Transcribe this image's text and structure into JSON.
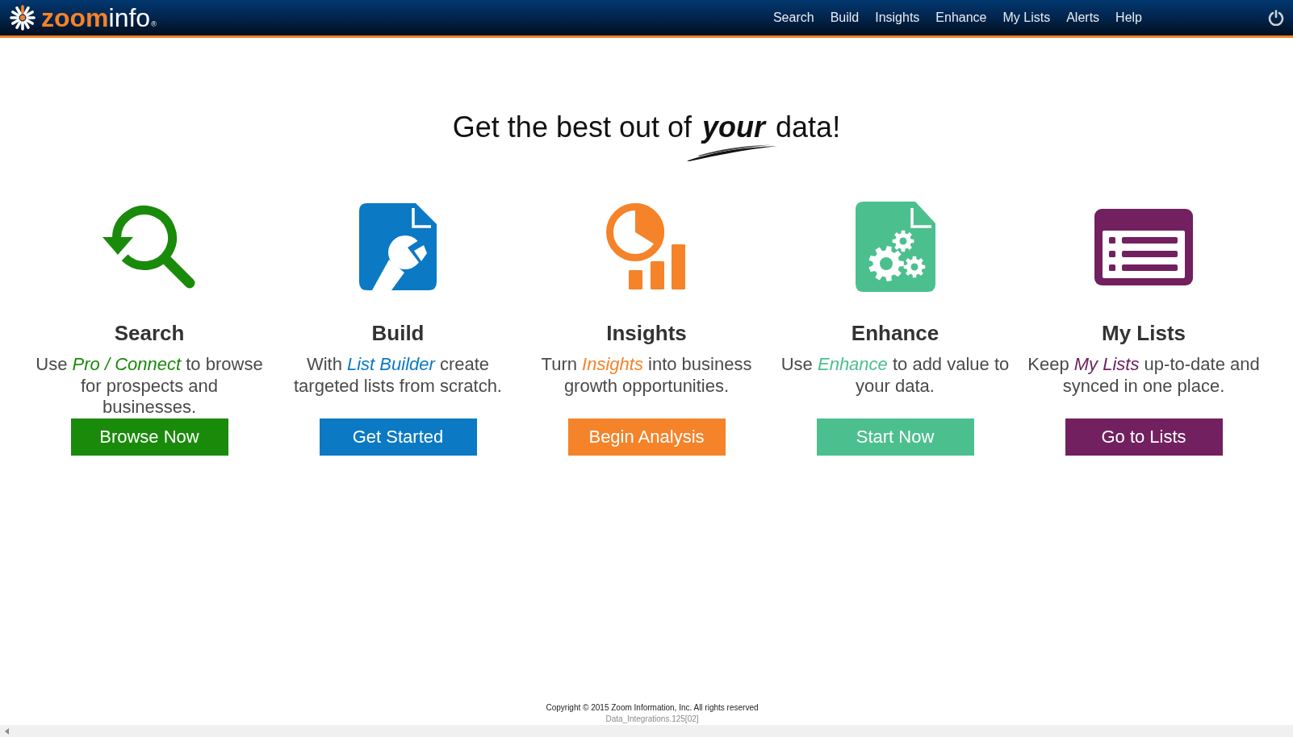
{
  "header": {
    "logo": {
      "words": [
        "zoom",
        "info"
      ],
      "mark": "®"
    },
    "nav": [
      "Search",
      "Build",
      "Insights",
      "Enhance",
      "My Lists",
      "Alerts",
      "Help"
    ]
  },
  "headline": "Get the best out of **your** data!",
  "features": [
    {
      "kind": "search",
      "title": "Search",
      "description": "Use *Pro / Connect* to browse for prospects and businesses.",
      "button": "Browse Now",
      "color": "#1a8a0b"
    },
    {
      "kind": "build",
      "title": "Build",
      "description": "With *List Builder* create targeted lists from scratch.",
      "button": "Get Started",
      "color": "#0b79c4"
    },
    {
      "kind": "insights",
      "title": "Insights",
      "description": "Turn *Insights* into business growth opportunities.",
      "button": "Begin Analysis",
      "color": "#f5832a"
    },
    {
      "kind": "enhance",
      "title": "Enhance",
      "description": "Use *Enhance* to add value to your data.",
      "button": "Start Now",
      "color": "#4cbf8e"
    },
    {
      "kind": "lists",
      "title": "My Lists",
      "description": "Keep *My Lists* up-to-date and synced in one place.",
      "button": "Go to Lists",
      "color": "#72205f"
    }
  ],
  "footer": {
    "copyright": "Copyright © 2015 Zoom Information, Inc. All rights reserved",
    "build": "Data_Integrations.125[02]"
  }
}
